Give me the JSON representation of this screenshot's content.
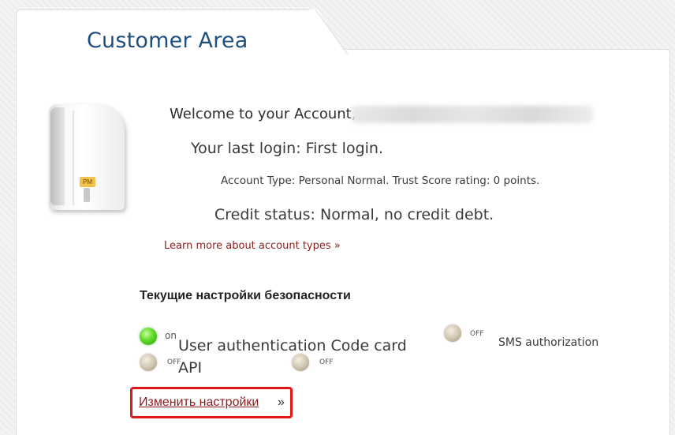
{
  "header": {
    "title": "Customer Area"
  },
  "device": {
    "badge": "PM"
  },
  "account": {
    "welcome": "Welcome to your Account,",
    "last_login": "Your last login: First login.",
    "account_type": "Account Type: Personal Normal. Trust Score rating: 0 points.",
    "credit_status": "Credit status: Normal, no credit debt.",
    "learn_more": "Learn more about account types »"
  },
  "security": {
    "heading": "Текущие настройки безопасности",
    "options": [
      {
        "label": "User authentication Code card",
        "state": "on",
        "color": "#5fd92a"
      },
      {
        "label": "SMS authorization",
        "state": "OFF",
        "color": "#cdc2ad"
      },
      {
        "label": "API",
        "state": "OFF",
        "color": "#cdc2ad"
      },
      {
        "label": "",
        "state": "OFF",
        "color": "#cdc2ad"
      }
    ],
    "change_link": "Изменить настройки",
    "change_arrow": "»"
  },
  "colors": {
    "title": "#1f4f7f",
    "link": "#8b1d1d",
    "highlight": "#e01818"
  }
}
